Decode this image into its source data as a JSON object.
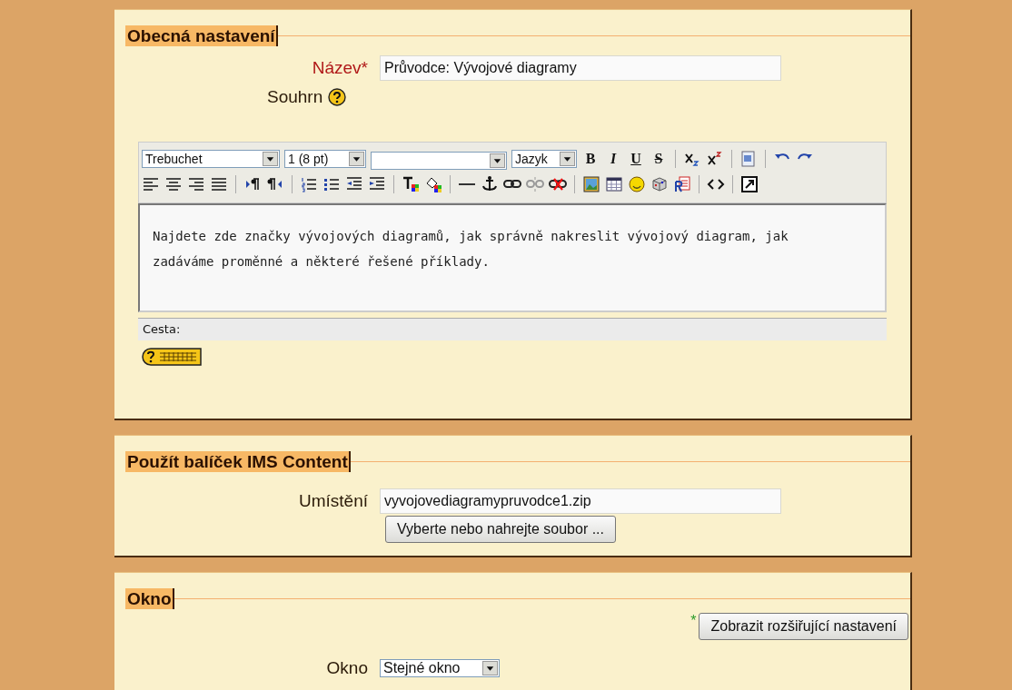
{
  "sections": [
    {
      "legend": "Obecná nastavení",
      "rows": [
        {
          "kind": "text",
          "label": "Název",
          "required_mark": "*",
          "value": "Průvodce: Vývojové diagramy"
        },
        {
          "kind": "help",
          "label": "Souhrn"
        },
        {
          "kind": "editor",
          "font": "Trebuchet",
          "size": "1 (8 pt)",
          "language": "Jazyk",
          "format_buttons": [
            "B",
            "I",
            "U",
            "S"
          ],
          "content": "Najdete zde značky vývojových diagramů, jak správně nakreslit vývojový diagram, jak zadáváme proměnné a některé řešené příklady.",
          "path_label": "Cesta:"
        }
      ]
    },
    {
      "legend": "Použít balíček IMS Content",
      "rows": [
        {
          "kind": "file",
          "label": "Umístění",
          "value": "vyvojovediagramypruvodce1.zip",
          "button": "Vyberte nebo nahrejte soubor ..."
        }
      ]
    },
    {
      "legend": "Okno",
      "rows": [
        {
          "kind": "advanced",
          "mark": "*",
          "button": "Zobrazit rozšiřující nastavení"
        },
        {
          "kind": "select",
          "label": "Okno",
          "value": "Stejné okno"
        }
      ]
    }
  ]
}
